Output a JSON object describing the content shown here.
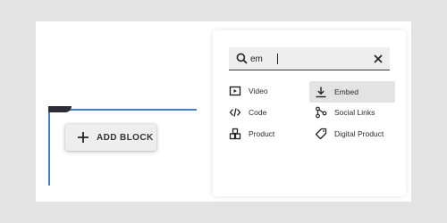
{
  "add_block": {
    "label": "ADD BLOCK",
    "icon": "plus-icon"
  },
  "search": {
    "value": "em",
    "icon": "search-icon",
    "clear_icon": "close-icon"
  },
  "blocks": [
    {
      "label": "Video",
      "icon": "video-icon",
      "selected": false
    },
    {
      "label": "Embed",
      "icon": "download-icon",
      "selected": true
    },
    {
      "label": "Code",
      "icon": "code-icon",
      "selected": false
    },
    {
      "label": "Social Links",
      "icon": "share-icon",
      "selected": false
    },
    {
      "label": "Product",
      "icon": "product-icon",
      "selected": false
    },
    {
      "label": "Digital Product",
      "icon": "tag-icon",
      "selected": false
    }
  ],
  "colors": {
    "frame_border": "#3a82d6",
    "selected_bg": "#e3e3e3",
    "canvas_bg": "#ffffff",
    "page_bg": "#e3e3e3"
  }
}
